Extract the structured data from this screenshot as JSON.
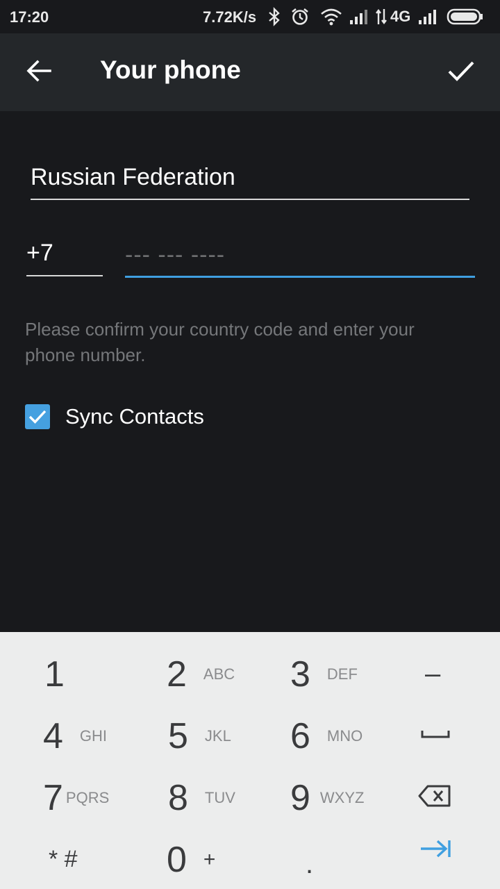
{
  "status_bar": {
    "time": "17:20",
    "net_speed": "7.72K/s",
    "network_type": "4G",
    "icons": [
      "bluetooth-icon",
      "alarm-icon",
      "wifi-icon",
      "signal-icon",
      "signal-icon",
      "battery-icon"
    ]
  },
  "app_bar": {
    "title": "Your phone",
    "back_icon": "arrow-left-icon",
    "done_icon": "check-icon"
  },
  "form": {
    "country": "Russian Federation",
    "country_code": "+7",
    "phone_value": "",
    "phone_placeholder": "--- --- ----",
    "hint": "Please confirm your country code and enter your phone number.",
    "sync_contacts_label": "Sync Contacts",
    "sync_contacts_checked": true
  },
  "keypad": {
    "keys": [
      {
        "digit": "1",
        "letters": ""
      },
      {
        "digit": "2",
        "letters": "ABC"
      },
      {
        "digit": "3",
        "letters": "DEF"
      },
      {
        "symbol": "–"
      },
      {
        "digit": "4",
        "letters": "GHI"
      },
      {
        "digit": "5",
        "letters": "JKL"
      },
      {
        "digit": "6",
        "letters": "MNO"
      },
      {
        "icon": "space-icon"
      },
      {
        "digit": "7",
        "letters": "PQRS"
      },
      {
        "digit": "8",
        "letters": "TUV"
      },
      {
        "digit": "9",
        "letters": "WXYZ"
      },
      {
        "icon": "backspace-icon"
      },
      {
        "symbol": "* #"
      },
      {
        "digit": "0",
        "letters": "+"
      },
      {
        "symbol": "."
      },
      {
        "icon": "next-tab-icon"
      }
    ]
  },
  "colors": {
    "background": "#18191c",
    "app_bar": "#24272a",
    "accent": "#3f9fe0",
    "checkbox": "#45a0e0",
    "hint_text": "#75777a",
    "keypad_bg": "#eceded"
  }
}
